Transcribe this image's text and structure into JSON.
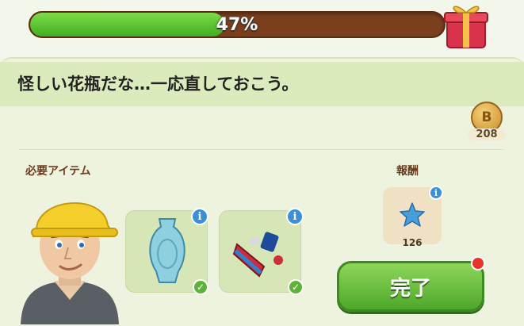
{
  "progress": {
    "percent_label": "47%",
    "value": 0.47
  },
  "quest": {
    "message": "怪しい花瓶だな…一応直しておこう。"
  },
  "coin": {
    "symbol": "B",
    "count": "208"
  },
  "required": {
    "label": "必要アイテム",
    "items": [
      {
        "icon": "vase-icon"
      },
      {
        "icon": "glue-tube-icon"
      }
    ]
  },
  "reward": {
    "label": "報酬",
    "icon": "blue-star-icon",
    "count": "126"
  },
  "complete_button": {
    "label": "完了"
  },
  "colors": {
    "progress_fill": "#4fbf2a",
    "progress_track": "#7a3f1c",
    "button": "#5cb337",
    "info": "#3b8fd6"
  }
}
